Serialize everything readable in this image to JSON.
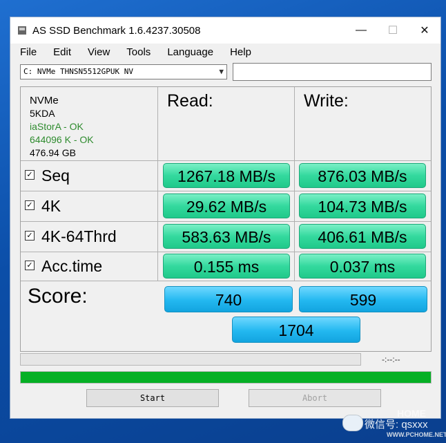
{
  "window": {
    "title": "AS SSD Benchmark 1.6.4237.30508",
    "minimize": "—",
    "maximize": "☐",
    "close": "✕"
  },
  "menu": [
    "File",
    "Edit",
    "View",
    "Tools",
    "Language",
    "Help"
  ],
  "drive": {
    "selected": "C: NVMe THNSN5512GPUK NV",
    "text": ""
  },
  "info": {
    "device": "NVMe",
    "firmware": "5KDA",
    "driver_status": "iaStorA - OK",
    "alignment_status": "644096 K - OK",
    "capacity": "476.94 GB"
  },
  "headers": {
    "read": "Read:",
    "write": "Write:"
  },
  "rows": [
    {
      "label": "Seq",
      "checked": true,
      "read": "1267.18 MB/s",
      "write": "876.03 MB/s"
    },
    {
      "label": "4K",
      "checked": true,
      "read": "29.62 MB/s",
      "write": "104.73 MB/s"
    },
    {
      "label": "4K-64Thrd",
      "checked": true,
      "read": "583.63 MB/s",
      "write": "406.61 MB/s"
    },
    {
      "label": "Acc.time",
      "checked": true,
      "read": "0.155 ms",
      "write": "0.037 ms"
    }
  ],
  "score": {
    "label": "Score:",
    "read": "740",
    "write": "599",
    "total": "1704"
  },
  "progress": {
    "time": "-:--:--",
    "fraction": 0,
    "overall_fraction": 1.0
  },
  "buttons": {
    "start": "Start",
    "abort": "Abort"
  },
  "watermark": {
    "text": "微信号: qsxxx",
    "brand": "WWW.PCHOME.NET",
    "phome": "HOME"
  },
  "colors": {
    "value_bg": "#34d99e",
    "score_bg": "#23b8f0",
    "progress_fill": "#06b025",
    "ok_text": "#2e8b2e"
  }
}
